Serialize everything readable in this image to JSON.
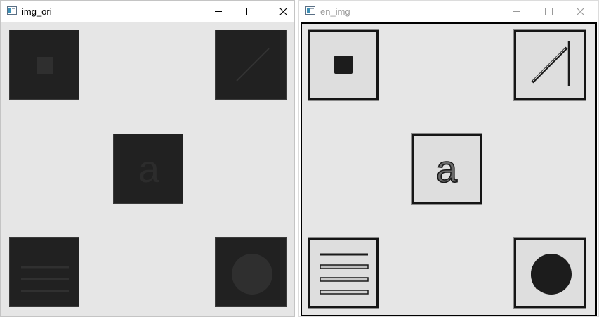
{
  "windows": [
    {
      "title": "img_ori",
      "controls": {
        "minimize": "minimize-icon",
        "maximize": "maximize-icon",
        "close": "close-icon"
      },
      "style": "original-dark",
      "tiles": [
        {
          "name": "square-tile",
          "letter": ""
        },
        {
          "name": "diagonal-line-tile",
          "letter": ""
        },
        {
          "name": "letter-tile",
          "letter": "a"
        },
        {
          "name": "lines-tile",
          "letter": ""
        },
        {
          "name": "circle-tile",
          "letter": ""
        }
      ],
      "colors": {
        "tile_bg": "#212121",
        "shape": "#2e2e2e",
        "canvas": "#e6e6e6"
      }
    },
    {
      "title": "en_img",
      "controls": {
        "minimize": "minimize-icon",
        "maximize": "maximize-icon",
        "close": "close-icon"
      },
      "style": "enhanced",
      "tiles": [
        {
          "name": "square-tile",
          "letter": ""
        },
        {
          "name": "diagonal-line-tile",
          "letter": ""
        },
        {
          "name": "letter-tile",
          "letter": "a"
        },
        {
          "name": "lines-tile",
          "letter": ""
        },
        {
          "name": "circle-tile",
          "letter": ""
        }
      ],
      "colors": {
        "tile_bg": "#dedede",
        "shape": "#1a1a1a",
        "border": "#151515",
        "canvas": "#e6e6e6"
      }
    }
  ]
}
